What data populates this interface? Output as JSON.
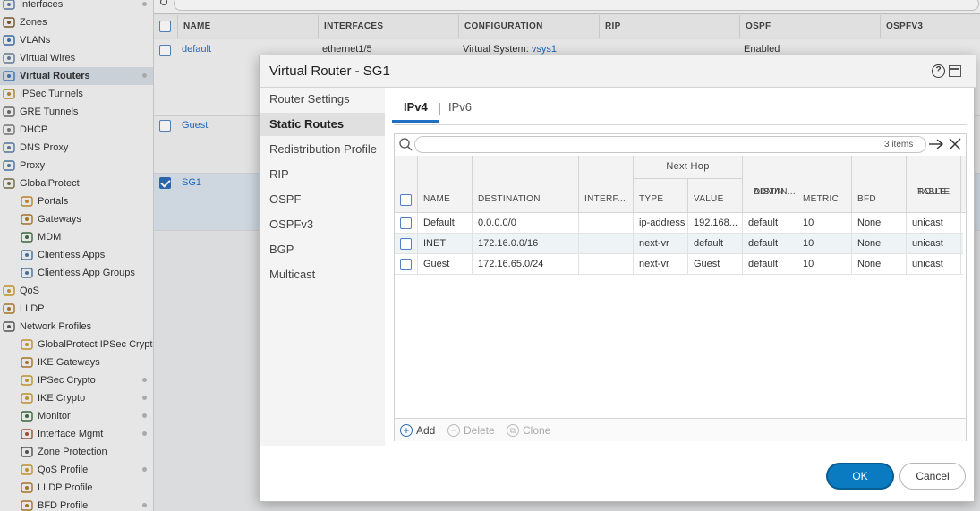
{
  "sidebar": {
    "items": [
      {
        "label": "Interfaces",
        "icon": "interfaces-icon",
        "active": false,
        "dot": true
      },
      {
        "label": "Zones",
        "icon": "zones-icon",
        "active": false,
        "dot": false
      },
      {
        "label": "VLANs",
        "icon": "vlans-icon",
        "active": false,
        "dot": false
      },
      {
        "label": "Virtual Wires",
        "icon": "virtual-wires-icon",
        "active": false,
        "dot": false
      },
      {
        "label": "Virtual Routers",
        "icon": "virtual-routers-icon",
        "active": true,
        "dot": true
      },
      {
        "label": "IPSec Tunnels",
        "icon": "ipsec-tunnels-icon",
        "active": false,
        "dot": false
      },
      {
        "label": "GRE Tunnels",
        "icon": "gre-tunnels-icon",
        "active": false,
        "dot": false
      },
      {
        "label": "DHCP",
        "icon": "dhcp-icon",
        "active": false,
        "dot": false
      },
      {
        "label": "DNS Proxy",
        "icon": "dns-proxy-icon",
        "active": false,
        "dot": false
      },
      {
        "label": "Proxy",
        "icon": "proxy-icon",
        "active": false,
        "dot": false
      },
      {
        "label": "GlobalProtect",
        "icon": "globalprotect-icon",
        "active": false,
        "dot": false
      },
      {
        "label": "Portals",
        "icon": "portals-icon",
        "active": false,
        "dot": false
      },
      {
        "label": "Gateways",
        "icon": "gateways-icon",
        "active": false,
        "dot": false
      },
      {
        "label": "MDM",
        "icon": "mdm-icon",
        "active": false,
        "dot": false
      },
      {
        "label": "Clientless Apps",
        "icon": "clientless-apps-icon",
        "active": false,
        "dot": false
      },
      {
        "label": "Clientless App Groups",
        "icon": "clientless-app-groups-icon",
        "active": false,
        "dot": false
      },
      {
        "label": "QoS",
        "icon": "qos-icon",
        "active": false,
        "dot": false
      },
      {
        "label": "LLDP",
        "icon": "lldp-icon",
        "active": false,
        "dot": false
      },
      {
        "label": "Network Profiles",
        "icon": "network-profiles-icon",
        "active": false,
        "dot": false
      },
      {
        "label": "GlobalProtect IPSec Crypto",
        "icon": "gp-ipsec-crypto-icon",
        "active": false,
        "dot": false
      },
      {
        "label": "IKE Gateways",
        "icon": "ike-gateways-icon",
        "active": false,
        "dot": false
      },
      {
        "label": "IPSec Crypto",
        "icon": "ipsec-crypto-icon",
        "active": false,
        "dot": true
      },
      {
        "label": "IKE Crypto",
        "icon": "ike-crypto-icon",
        "active": false,
        "dot": true
      },
      {
        "label": "Monitor",
        "icon": "monitor-icon",
        "active": false,
        "dot": true
      },
      {
        "label": "Interface Mgmt",
        "icon": "interface-mgmt-icon",
        "active": false,
        "dot": true
      },
      {
        "label": "Zone Protection",
        "icon": "zone-protection-icon",
        "active": false,
        "dot": false
      },
      {
        "label": "QoS Profile",
        "icon": "qos-profile-icon",
        "active": false,
        "dot": true
      },
      {
        "label": "LLDP Profile",
        "icon": "lldp-profile-icon",
        "active": false,
        "dot": false
      },
      {
        "label": "BFD Profile",
        "icon": "bfd-profile-icon",
        "active": false,
        "dot": true
      }
    ]
  },
  "background_table": {
    "columns": [
      "NAME",
      "INTERFACES",
      "CONFIGURATION",
      "RIP",
      "OSPF",
      "OSPFV3"
    ],
    "rows": [
      {
        "name": "default",
        "interfaces": "ethernet1/5",
        "configuration_prefix": "Virtual System:",
        "configuration_link": "vsys1",
        "ospf": "Enabled",
        "checked": false
      },
      {
        "name": "Guest",
        "checked": false
      },
      {
        "name": "SG1",
        "checked": true
      }
    ]
  },
  "modal": {
    "title": "Virtual Router - SG1",
    "help_icon_glyph": "?",
    "nav": [
      {
        "label": "Router Settings",
        "active": false
      },
      {
        "label": "Static Routes",
        "active": true
      },
      {
        "label": "Redistribution Profile",
        "active": false
      },
      {
        "label": "RIP",
        "active": false
      },
      {
        "label": "OSPF",
        "active": false
      },
      {
        "label": "OSPFv3",
        "active": false
      },
      {
        "label": "BGP",
        "active": false
      },
      {
        "label": "Multicast",
        "active": false
      }
    ],
    "tabs": [
      {
        "label": "IPv4",
        "active": true
      },
      {
        "label": "IPv6",
        "active": false
      }
    ],
    "search": {
      "value": "",
      "placeholder": ""
    },
    "items_count": "3 items",
    "grid": {
      "group_header": "Next Hop",
      "columns": {
        "name": "NAME",
        "destination": "DESTINATION",
        "interface": "INTERF...",
        "type": "TYPE",
        "value": "VALUE",
        "admin_distance_line1": "ADMIN",
        "admin_distance_line2": "DISTAN...",
        "metric": "METRIC",
        "bfd": "BFD",
        "route_table_line1": "ROUTE",
        "route_table_line2": "TABLE"
      },
      "rows": [
        {
          "name": "Default",
          "destination": "0.0.0.0/0",
          "interface": "",
          "type": "ip-address",
          "value": "192.168...",
          "admin_distance": "default",
          "metric": "10",
          "bfd": "None",
          "route_table": "unicast"
        },
        {
          "name": "INET",
          "destination": "172.16.0.0/16",
          "interface": "",
          "type": "next-vr",
          "value": "default",
          "admin_distance": "default",
          "metric": "10",
          "bfd": "None",
          "route_table": "unicast"
        },
        {
          "name": "Guest",
          "destination": "172.16.65.0/24",
          "interface": "",
          "type": "next-vr",
          "value": "Guest",
          "admin_distance": "default",
          "metric": "10",
          "bfd": "None",
          "route_table": "unicast"
        }
      ]
    },
    "footer_buttons": {
      "add": "Add",
      "delete": "Delete",
      "clone": "Clone"
    },
    "ok_label": "OK",
    "cancel_label": "Cancel"
  },
  "colors": {
    "accent": "#1f6fc5",
    "ok_button": "#0a7bc1",
    "active_nav": "#d6dde6"
  }
}
